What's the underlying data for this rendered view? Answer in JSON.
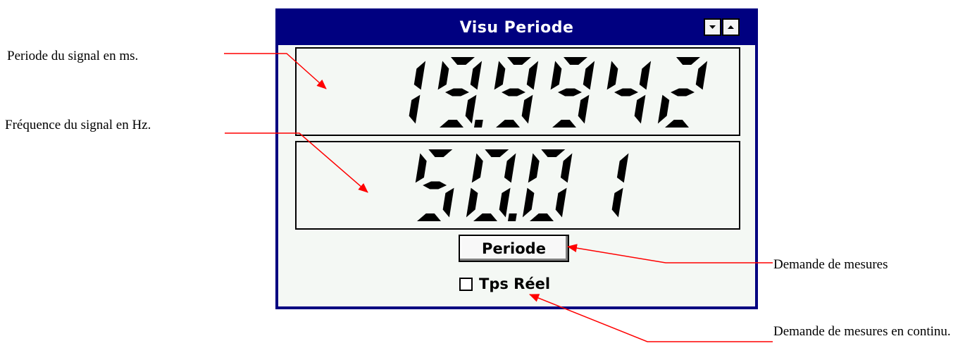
{
  "annotations": {
    "period": "Periode du signal en ms.",
    "frequency": "Fréquence du signal en Hz.",
    "measure_request": "Demande de mesures",
    "continuous_request": "Demande de mesures en continu."
  },
  "window": {
    "title": "Visu Periode",
    "period_display": "19.9942",
    "frequency_display": "50.01",
    "button_label": "Periode",
    "checkbox_label": "Tps Réel",
    "checkbox_checked": false
  },
  "colors": {
    "titlebar": "#000080",
    "lcd_segment": "#000000",
    "client_bg": "#f4f8f4",
    "annotation_arrow": "#ff0000"
  }
}
